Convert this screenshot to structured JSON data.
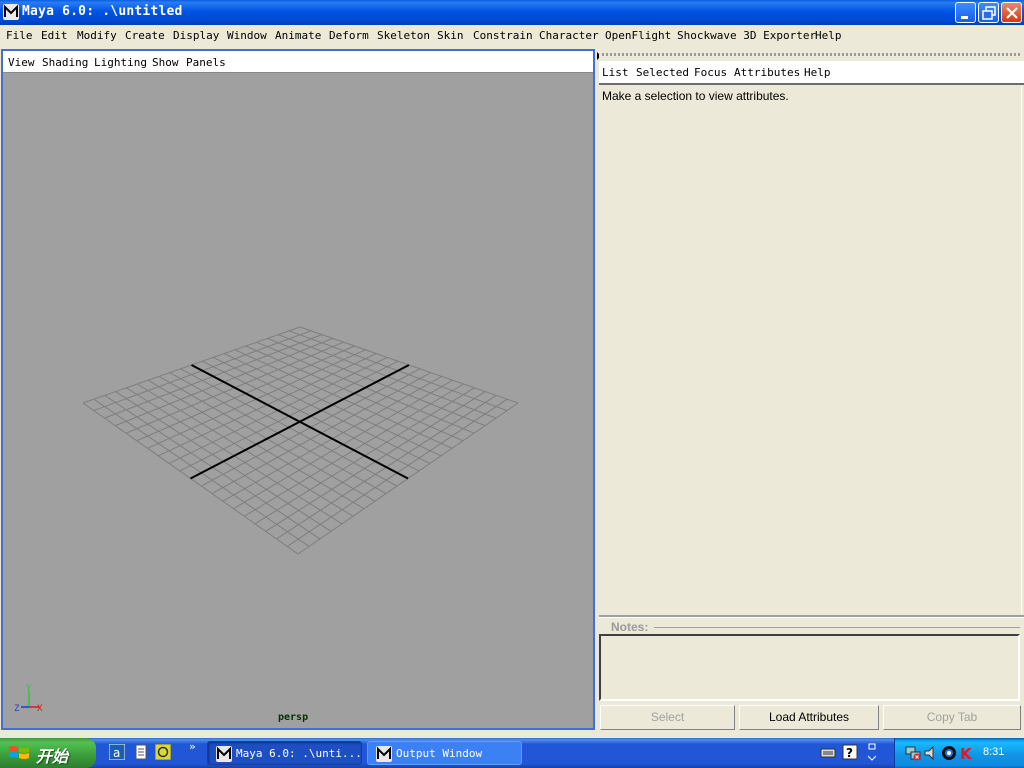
{
  "window": {
    "title": "Maya 6.0: .\\untitled"
  },
  "main_menu": [
    "File",
    "Edit",
    "Modify",
    "Create",
    "Display",
    "Window",
    "Animate",
    "Deform",
    "Skeleton",
    "Skin",
    "Constrain",
    "Character",
    "OpenFlight",
    "Shockwave 3D Exporter",
    "Help"
  ],
  "viewport": {
    "menu": [
      "View",
      "Shading",
      "Lighting",
      "Show",
      "Panels"
    ],
    "camera_label": "persp",
    "axis_labels": {
      "x": "X",
      "y": "Y",
      "z": "Z"
    }
  },
  "attribute_editor": {
    "menu": [
      "List",
      "Selected",
      "Focus",
      "Attributes",
      "Help"
    ],
    "message": "Make a selection to view attributes.",
    "notes_label": "Notes:",
    "notes_value": "",
    "buttons": {
      "select": "Select",
      "load_attributes": "Load Attributes",
      "copy_tab": "Copy Tab"
    }
  },
  "taskbar": {
    "start_label": "开始",
    "tasks": [
      {
        "label": "Maya 6.0: .\\unti...",
        "active": true
      },
      {
        "label": "Output Window",
        "active": false
      }
    ],
    "clock": "8:31"
  }
}
